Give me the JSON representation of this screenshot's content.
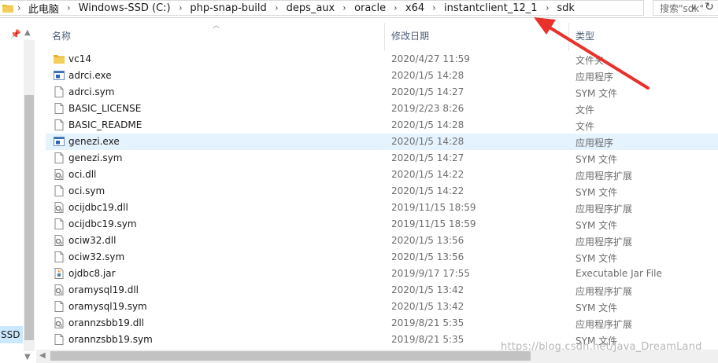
{
  "address_bar": {
    "breadcrumbs": [
      "此电脑",
      "Windows-SSD (C:)",
      "php-snap-build",
      "deps_aux",
      "oracle",
      "x64",
      "instantclient_12_1",
      "sdk"
    ],
    "separator": "›",
    "dropdown_icon": "chevron-down-icon",
    "refresh_icon": "refresh-icon"
  },
  "search": {
    "placeholder": "搜索\"sdk\""
  },
  "nav_pane": {
    "pinned_item": "SSD"
  },
  "columns": {
    "name": "名称",
    "date": "修改日期",
    "type": "类型"
  },
  "files": [
    {
      "name": "vc14",
      "date": "2020/4/27 11:59",
      "type": "文件夹",
      "icon": "folder-icon"
    },
    {
      "name": "adrci.exe",
      "date": "2020/1/5 14:28",
      "type": "应用程序",
      "icon": "exe-icon"
    },
    {
      "name": "adrci.sym",
      "date": "2020/1/5 14:27",
      "type": "SYM 文件",
      "icon": "file-icon"
    },
    {
      "name": "BASIC_LICENSE",
      "date": "2019/2/23 8:26",
      "type": "文件",
      "icon": "file-icon"
    },
    {
      "name": "BASIC_README",
      "date": "2020/1/5 14:28",
      "type": "文件",
      "icon": "file-icon"
    },
    {
      "name": "genezi.exe",
      "date": "2020/1/5 14:28",
      "type": "应用程序",
      "icon": "exe-icon",
      "selected": true
    },
    {
      "name": "genezi.sym",
      "date": "2020/1/5 14:27",
      "type": "SYM 文件",
      "icon": "file-icon"
    },
    {
      "name": "oci.dll",
      "date": "2020/1/5 14:22",
      "type": "应用程序扩展",
      "icon": "dll-icon"
    },
    {
      "name": "oci.sym",
      "date": "2020/1/5 14:22",
      "type": "SYM 文件",
      "icon": "file-icon"
    },
    {
      "name": "ocijdbc19.dll",
      "date": "2019/11/15 18:59",
      "type": "应用程序扩展",
      "icon": "dll-icon"
    },
    {
      "name": "ocijdbc19.sym",
      "date": "2019/11/15 18:59",
      "type": "SYM 文件",
      "icon": "file-icon"
    },
    {
      "name": "ociw32.dll",
      "date": "2020/1/5 13:56",
      "type": "应用程序扩展",
      "icon": "dll-icon"
    },
    {
      "name": "ociw32.sym",
      "date": "2020/1/5 13:56",
      "type": "SYM 文件",
      "icon": "file-icon"
    },
    {
      "name": "ojdbc8.jar",
      "date": "2019/9/17 17:55",
      "type": "Executable Jar File",
      "icon": "jar-icon"
    },
    {
      "name": "oramysql19.dll",
      "date": "2020/1/5 13:42",
      "type": "应用程序扩展",
      "icon": "dll-icon"
    },
    {
      "name": "oramysql19.sym",
      "date": "2020/1/5 13:42",
      "type": "SYM 文件",
      "icon": "file-icon"
    },
    {
      "name": "orannzsbb19.dll",
      "date": "2019/8/21 5:35",
      "type": "应用程序扩展",
      "icon": "dll-icon"
    },
    {
      "name": "orannzsbb19.sym",
      "date": "2019/8/21 5:35",
      "type": "SYM 文件",
      "icon": "file-icon"
    }
  ],
  "watermark": "https://blog.csdn.net/Java_DreamLand",
  "colors": {
    "selected_row": "#e5f3ff",
    "nav_selected": "#cce8ff",
    "header_text": "#4c607a",
    "annotation_arrow": "#e8312a"
  }
}
